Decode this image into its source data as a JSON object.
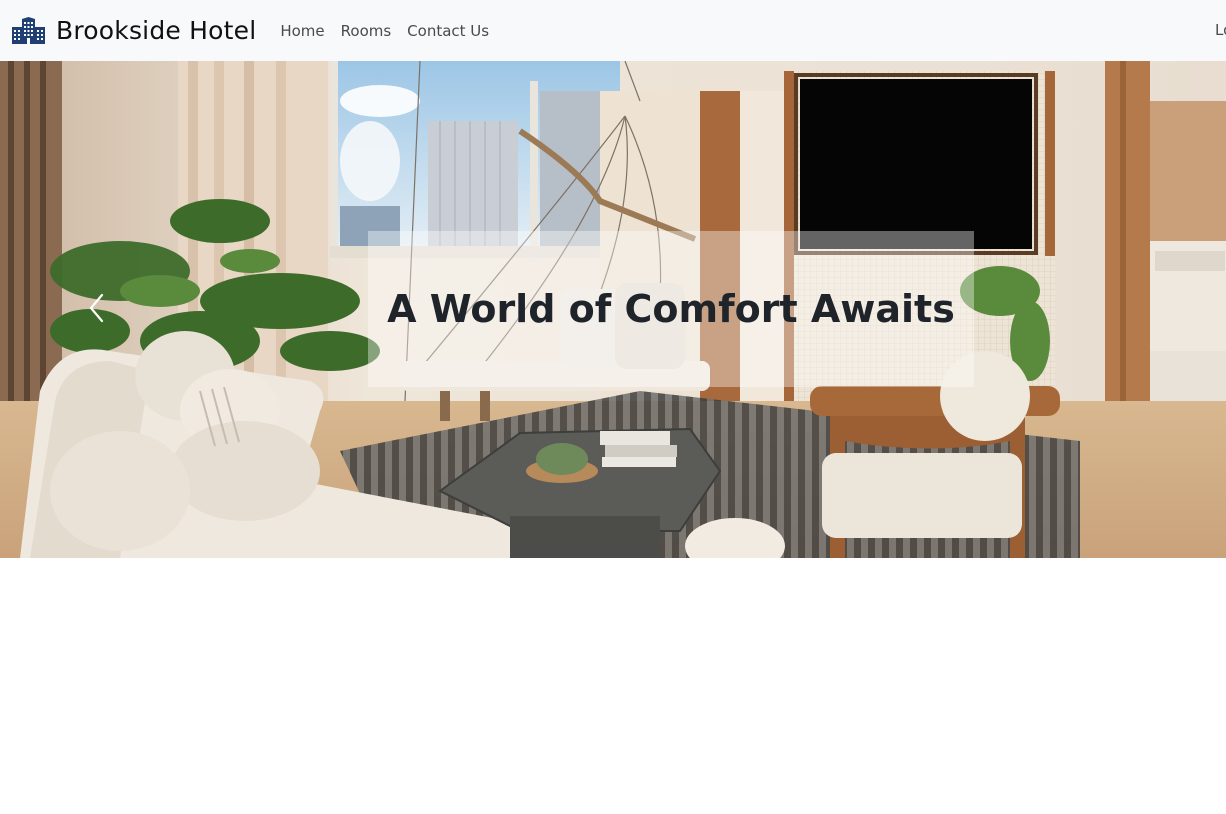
{
  "brand": {
    "name": "Brookside Hotel",
    "icon": "hotel-building-icon"
  },
  "nav": {
    "items": [
      {
        "label": "Home"
      },
      {
        "label": "Rooms"
      },
      {
        "label": "Contact Us"
      }
    ],
    "right_label": "Lo"
  },
  "hero": {
    "caption": "A World of Comfort Awaits",
    "prev_icon": "chevron-left-icon"
  },
  "colors": {
    "navbar_bg": "#f8f9fa",
    "brand_blue": "#1f3f75",
    "caption_text": "#1f242b"
  }
}
